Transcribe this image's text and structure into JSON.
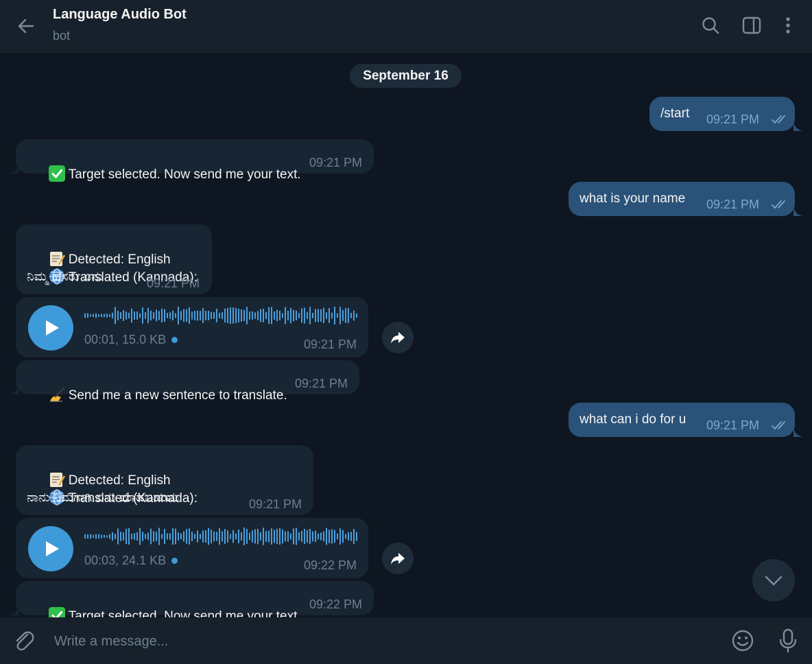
{
  "header": {
    "title": "Language Audio Bot",
    "subtitle": "bot"
  },
  "chat": {
    "date_label": "September 16",
    "messages": [
      {
        "dir": "out",
        "text": "/start",
        "time": "09:21 PM"
      },
      {
        "dir": "in",
        "emoji": "check-mark-emoji",
        "text": "Target selected. Now send me your text.",
        "time": "09:21 PM"
      },
      {
        "dir": "out",
        "text": "what is your name",
        "time": "09:21 PM"
      },
      {
        "dir": "in",
        "line1": "Detected: English",
        "line2": "Translated (Kannada):",
        "line3": "ನಿಮ್ಮ ಹೆಸರು ಏನು",
        "time": "09:21 PM"
      },
      {
        "dir": "in",
        "type": "voice",
        "duration": "00:01, 15.0 KB",
        "time": "09:21 PM"
      },
      {
        "dir": "in",
        "emoji": "writing-hand-emoji",
        "text": "Send me a new sentence to translate.",
        "time": "09:21 PM"
      },
      {
        "dir": "out",
        "text": "what can i do for u",
        "time": "09:21 PM"
      },
      {
        "dir": "in",
        "line1": "Detected: English",
        "line2": "Translated (Kannada):",
        "line3": "ನಾನು ನಿಮಗಾಗಿ ಏನು ಮಾಡಬಹುದು",
        "time": "09:21 PM"
      },
      {
        "dir": "in",
        "type": "voice",
        "duration": "00:03, 24.1 KB",
        "time": "09:22 PM"
      },
      {
        "dir": "in",
        "emoji": "check-mark-emoji",
        "text": "Target selected. Now send me your text.",
        "time": "09:22 PM"
      }
    ]
  },
  "composer": {
    "placeholder": "Write a message..."
  },
  "colors": {
    "background": "#0e1621",
    "header": "#17212b",
    "incoming_bubble": "#182533",
    "outgoing_bubble": "#2b5278",
    "accent": "#3f9ad9",
    "check_green": "#2fbf4a"
  }
}
